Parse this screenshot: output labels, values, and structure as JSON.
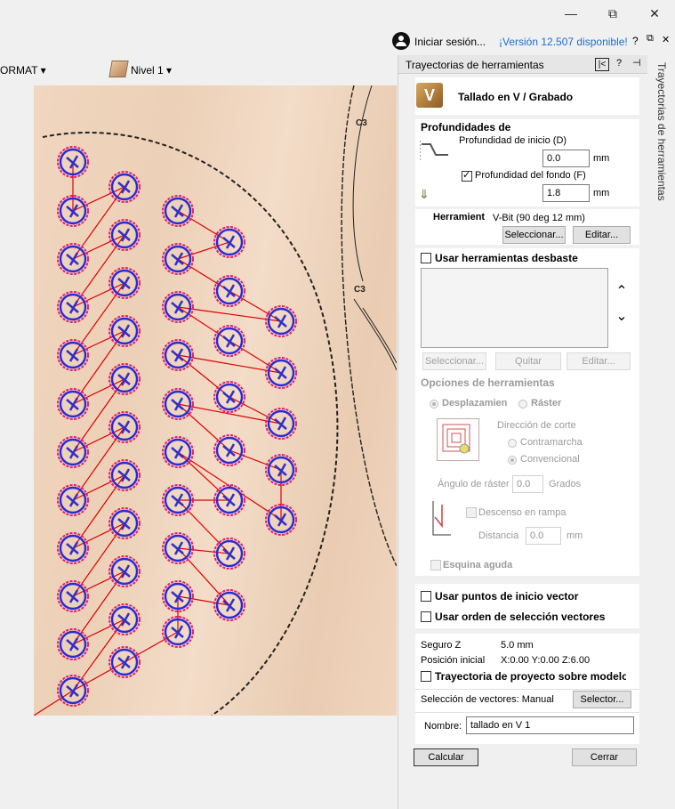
{
  "window": {
    "minimize": "—",
    "restore": "⧉",
    "close": "✕"
  },
  "account": {
    "signin": "Iniciar sesión...",
    "version": "¡Versión 12.507 disponible!",
    "help": "?",
    "min": "—",
    "restore": "⧉",
    "close": "✕"
  },
  "toolbar": {
    "format": "ORMAT",
    "layer": "Nivel 1"
  },
  "panel": {
    "title": "Trayectorias de herramientas",
    "side_tab": "Trayectorias de herramientas",
    "tool_type": "Tallado en V / Grabado",
    "depths": {
      "heading": "Profundidades de",
      "start_label": "Profundidad de inicio (D)",
      "start_value": "0.0",
      "start_unit": "mm",
      "bottom_label": "Profundidad del fondo (F)",
      "bottom_checked": true,
      "bottom_value": "1.8",
      "bottom_unit": "mm"
    },
    "tool": {
      "label": "Herramient",
      "name": "V-Bit (90 deg 12 mm)",
      "select": "Seleccionar...",
      "edit": "Editar..."
    },
    "roughing": {
      "label": "Usar herramientas desbaste",
      "select": "Seleccionar...",
      "remove": "Quitar",
      "edit": "Editar...",
      "options": "Opciones de herramientas",
      "offset": "Desplazamien",
      "raster": "Ráster",
      "cut_direction": "Dirección de corte",
      "climb": "Contramarcha",
      "conventional": "Convencional",
      "raster_angle_label": "Ángulo de ráster",
      "raster_angle": "0.0",
      "degrees": "Grados",
      "ramp": "Descenso en rampa",
      "distance_label": "Distancia",
      "distance": "0.0",
      "distance_unit": "mm",
      "sharp_corner": "Esquina aguda"
    },
    "vector_start": "Usar puntos de inicio vector",
    "vector_order": "Usar orden de selección vectores",
    "info": {
      "safe_z_label": "Seguro Z",
      "safe_z": "5.0 mm",
      "home_label": "Posición inicial",
      "home": "X:0.00 Y:0.00 Z:6.00",
      "project_label": "Trayectoria de proyecto sobre modelo"
    },
    "selection": {
      "label": "Selección de vectores: Manual",
      "button": "Selector..."
    },
    "name": {
      "label": "Nombre:",
      "value": "tallado en V 1"
    },
    "calculate": "Calcular",
    "close": "Cerrar"
  },
  "canvas_labels": [
    "C3",
    "C3"
  ]
}
